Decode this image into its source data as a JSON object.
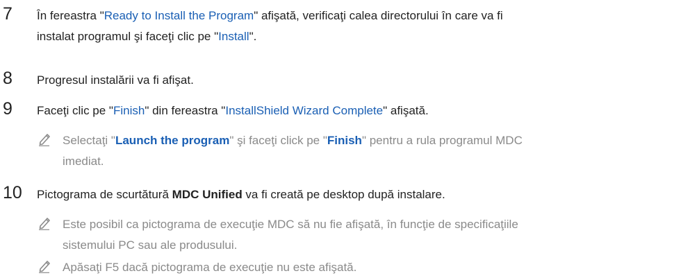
{
  "colors": {
    "text": "#222222",
    "note_text": "#8a8a8a",
    "highlight": "#1a5fb4"
  },
  "steps": [
    {
      "number": "7",
      "line1_pre": "În fereastra \"",
      "line1_link": "Ready to Install the Program",
      "line1_post": "\" afişată, verificaţi calea directorului în care va fi",
      "line2_pre": "instalat programul şi faceţi clic pe \"",
      "line2_link": "Install",
      "line2_post": "\"."
    },
    {
      "number": "8",
      "text": "Progresul instalării va fi afişat."
    },
    {
      "number": "9",
      "pre": "Faceţi clic pe \"",
      "link1": "Finish",
      "mid": "\" din fereastra \"",
      "link2": "InstallShield Wizard Complete",
      "post": "\" afişată.",
      "note": {
        "icon": "pencil-icon",
        "line1_pre": "Selectaţi \"",
        "line1_link1": "Launch the program",
        "line1_mid": "\" şi faceţi click pe \"",
        "line1_link2": "Finish",
        "line1_post": "\" pentru a rula programul MDC",
        "line2": "imediat."
      }
    },
    {
      "number": "10",
      "pre": "Pictograma de scurtătură ",
      "bold": "MDC Unified",
      "post": " va fi creată pe desktop după instalare.",
      "notes": [
        {
          "icon": "pencil-icon",
          "line1": "Este posibil ca pictograma de execuţie MDC să nu fie afişată, în funcţie de specificaţiile",
          "line2": "sistemului PC sau ale produsului."
        },
        {
          "icon": "pencil-icon",
          "line1": "Apăsaţi F5 dacă pictograma de execuţie nu este afişată."
        }
      ]
    }
  ]
}
